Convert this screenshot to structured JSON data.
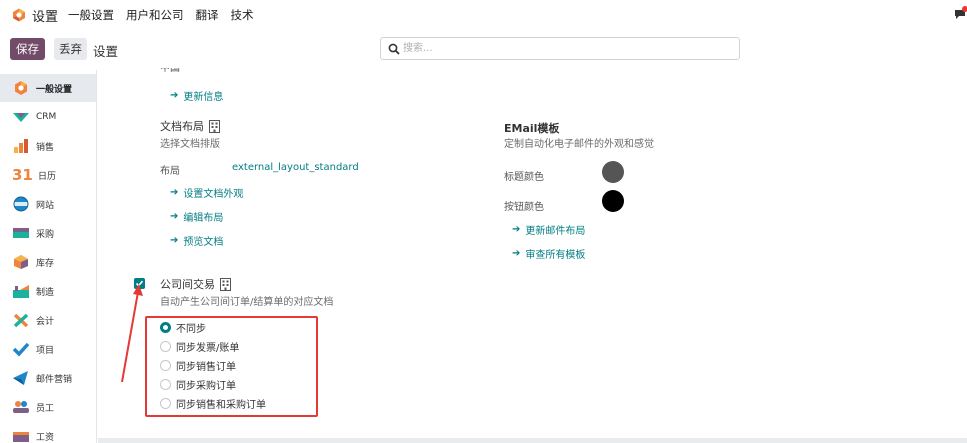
{
  "topbar": {
    "app_name": "设置",
    "menu": [
      "一般设置",
      "用户和公司",
      "翻译",
      "技术"
    ]
  },
  "controlbar": {
    "save_label": "保存",
    "discard_label": "丢弃",
    "breadcrumb": "设置",
    "search_placeholder": "搜索..."
  },
  "sidebar": {
    "items": [
      {
        "label": "一般设置",
        "icon": "settings-icon",
        "active": true
      },
      {
        "label": "CRM",
        "icon": "crm-icon"
      },
      {
        "label": "销售",
        "icon": "sales-icon"
      },
      {
        "label": "日历",
        "icon": "calendar-icon",
        "badge": "31"
      },
      {
        "label": "网站",
        "icon": "website-icon"
      },
      {
        "label": "采购",
        "icon": "purchase-icon"
      },
      {
        "label": "库存",
        "icon": "inventory-icon"
      },
      {
        "label": "制造",
        "icon": "manufacturing-icon"
      },
      {
        "label": "会计",
        "icon": "accounting-icon"
      },
      {
        "label": "项目",
        "icon": "project-icon"
      },
      {
        "label": "邮件营销",
        "icon": "email-marketing-icon"
      },
      {
        "label": "员工",
        "icon": "employees-icon"
      },
      {
        "label": "工资",
        "icon": "payroll-icon"
      }
    ]
  },
  "main": {
    "cut_text": "中国",
    "update_info_link": "更新信息",
    "document_layout": {
      "title": "文档布局",
      "desc": "选择文档排版",
      "layout_label": "布局",
      "layout_value": "external_layout_standard",
      "links": [
        "设置文档外观",
        "编辑布局",
        "预览文档"
      ]
    },
    "email_templates": {
      "title": "EMail模板",
      "desc": "定制自动化电子邮件的外观和感觉",
      "header_color_label": "标题颜色",
      "button_color_label": "按钮颜色",
      "header_color": "#555555",
      "button_color": "#000000",
      "links": [
        "更新邮件布局",
        "审查所有模板"
      ]
    },
    "inter_company": {
      "title": "公司间交易",
      "desc": "自动产生公司间订单/结算单的对应文档",
      "checked": true,
      "options": [
        {
          "label": "不同步",
          "selected": true
        },
        {
          "label": "同步发票/账单",
          "selected": false
        },
        {
          "label": "同步销售订单",
          "selected": false
        },
        {
          "label": "同步采购订单",
          "selected": false
        },
        {
          "label": "同步销售和采购订单",
          "selected": false
        }
      ]
    }
  },
  "colors": {
    "brand": "#714b67",
    "accent": "#017e84",
    "annotation": "#e53935"
  }
}
